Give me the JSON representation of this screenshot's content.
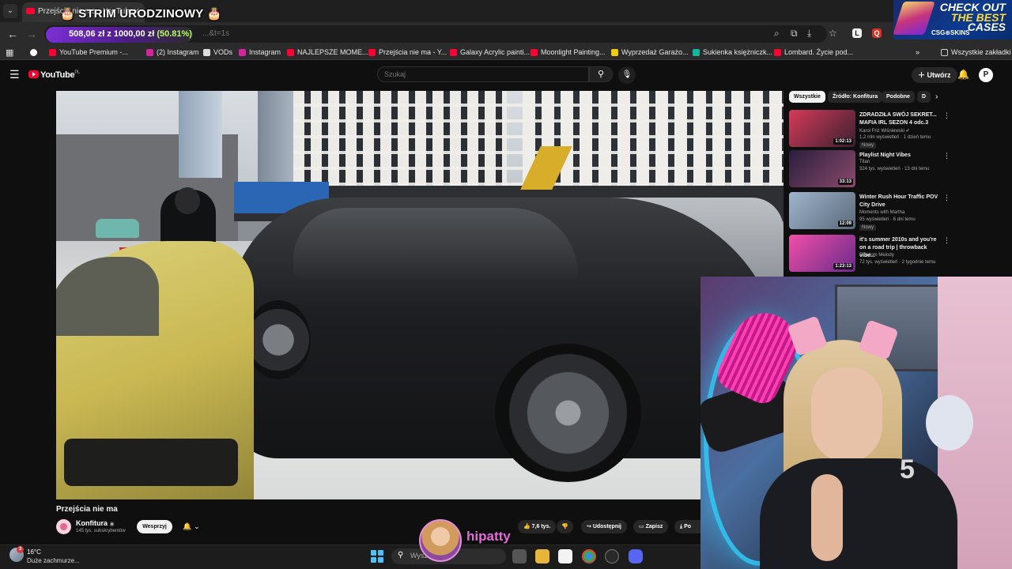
{
  "browser": {
    "tab_title": "Przejścia nie ma - YouTube",
    "stream_overlay_title": "🎂 STRIM URODZINOWY 🎂",
    "url_fragment": "...&t=1s",
    "donation_goal": {
      "text": "508,06 zł z 1000,00 zł",
      "percent": "(50.81%)",
      "progress": 0.5081
    },
    "bookmarks": [
      {
        "label": "YouTube Premium -...",
        "color": "#ff0033"
      },
      {
        "label": "(2) Instagram",
        "color": "#d6249f"
      },
      {
        "label": "VODs",
        "color": "#dddddd"
      },
      {
        "label": "Instagram",
        "color": "#d6249f"
      },
      {
        "label": "NAJLEPSZE MOME...",
        "color": "#ff0033"
      },
      {
        "label": "Przejścia nie ma - Y...",
        "color": "#ff0033"
      },
      {
        "label": "Galaxy Acrylic painti...",
        "color": "#ff0033"
      },
      {
        "label": "Moonlight Painting...",
        "color": "#ff0033"
      },
      {
        "label": "Wyprzedaż Garażo...",
        "color": "#f2c811"
      },
      {
        "label": "Sukienka księżniczk...",
        "color": "#13b5a0"
      },
      {
        "label": "Lombard. Życie pod...",
        "color": "#ff0033"
      }
    ],
    "all_bookmarks_label": "Wszystkie zakładki"
  },
  "ad": {
    "line1": "CHECK OUT",
    "line2": "THE BEST",
    "line3": "CASES",
    "brand": "CSG⊕SKINS"
  },
  "youtube": {
    "logo": "YouTube",
    "region": "PL",
    "search_placeholder": "Szukaj",
    "create_label": "Utwórz",
    "avatar_letter": "P",
    "video_title": "Przejścia nie ma",
    "channel_name": "Konfitura",
    "channel_subs": "145 tys. subskrybentów",
    "support_label": "Wesprzyj",
    "actions": {
      "likes": "7,6 tys.",
      "share": "Udostępnij",
      "save": "Zapisz",
      "more": "Po"
    },
    "chips": [
      "Wszystkie",
      "Źródło: Konfitura",
      "Podobne",
      "D"
    ],
    "recommendations": [
      {
        "title": "ZDRADZIŁA SWÓJ SEKRET... MAFIA IRL SEZON 4 odc.3",
        "channel": "Karol Friz Wiśniewski ✔",
        "meta": "1,2 mln wyświetleń · 1 dzień temu",
        "badge": "Nowy",
        "duration": "1:02:13",
        "thumb_colors": [
          "#d63a5a",
          "#3a2030"
        ]
      },
      {
        "title": "Playlist Night Vibes",
        "channel": "Titan",
        "meta": "324 tys. wyświetleń · 13 dni temu",
        "badge": "",
        "duration": "33:13",
        "thumb_colors": [
          "#2a1e3e",
          "#8a4a6a"
        ]
      },
      {
        "title": "Winter Rush Hour Traffic POV City Drive",
        "channel": "Moments with Martha",
        "meta": "95 wyświetleń · 6 dni temu",
        "badge": "Nowy",
        "duration": "12:09",
        "thumb_colors": [
          "#9fb4cc",
          "#5a6a7a"
        ]
      },
      {
        "title": "it's summer 2010s and you're on a road trip | throwback vibe...",
        "channel": "Random Melody",
        "meta": "72 tys. wyświetleń · 2 tygodnie temu",
        "badge": "",
        "duration": "1:23:13",
        "thumb_colors": [
          "#f04fa8",
          "#6a2a8a"
        ]
      }
    ]
  },
  "streamer": {
    "name": "hipatty"
  },
  "taskbar": {
    "weather_temp": "16°C",
    "weather_desc": "Duże zachmurze...",
    "weather_badge": "3",
    "search_placeholder": "Wysz"
  }
}
